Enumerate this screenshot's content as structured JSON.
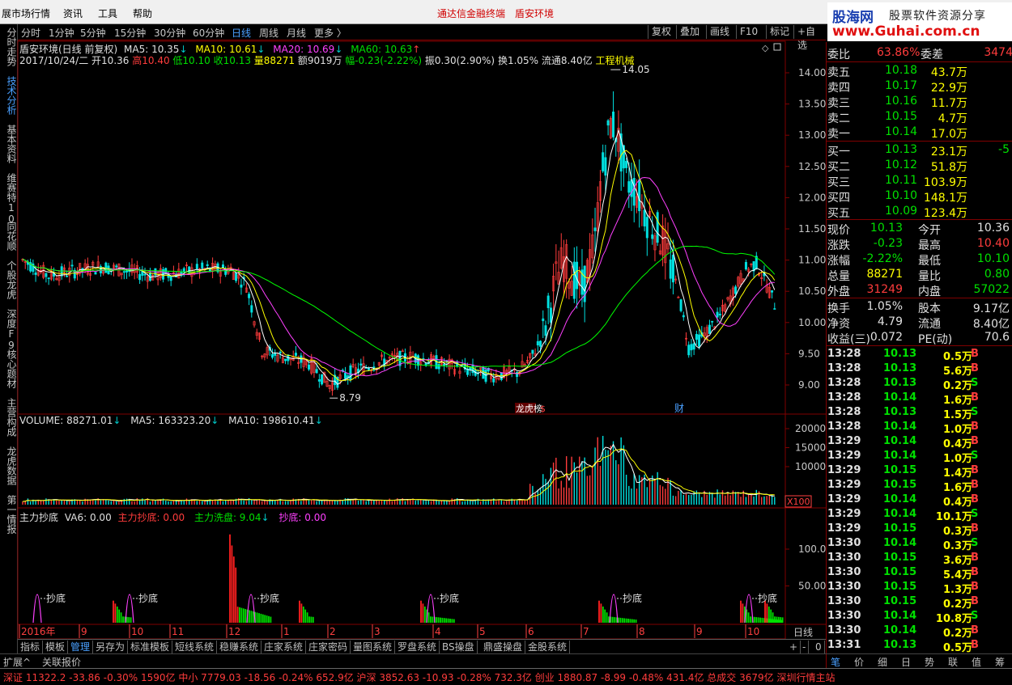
{
  "menubar": {
    "items": [
      "展市场行情",
      "资讯",
      "工具",
      "帮助"
    ],
    "center_links": [
      "通达信金融终端",
      "盾安环境"
    ]
  },
  "logo": {
    "brand": "股海网",
    "slogan": "股票软件资源分享",
    "url": "www.Guhai.com.cn"
  },
  "left_tabs": [
    "分时走势",
    "技术分析",
    "基本资料",
    "维赛特10",
    "同花顺",
    "个股龙虎",
    "深度F9",
    "核心题材",
    "主营构成",
    "龙虎数据",
    "第一情报"
  ],
  "periods": {
    "items": [
      "分时",
      "1分钟",
      "5分钟",
      "15分钟",
      "30分钟",
      "60分钟",
      "日线",
      "周线",
      "月线",
      "更多 〉"
    ],
    "active": "日线",
    "right_buttons": [
      "复权",
      "叠加",
      "画线",
      "F10",
      "标记",
      "+自选"
    ]
  },
  "price_panel": {
    "title": "盾安环境(日线 前复权)",
    "ma": [
      {
        "label": "MA5: 10.35",
        "color": "#ffffff"
      },
      {
        "label": "MA10: 10.61",
        "color": "#ffff00"
      },
      {
        "label": "MA20: 10.69",
        "color": "#ff40ff"
      },
      {
        "label": "MA60: 10.63",
        "color": "#00ff00"
      }
    ],
    "bar_info": {
      "date": "2017/10/24/二",
      "open": "开10.36",
      "high": "高10.40",
      "low": "低10.10",
      "close": "收10.13",
      "vol": "量88271",
      "amount": "额9019万",
      "change": "幅-0.23(-2.22%)",
      "amp": "振0.30(2.90%)",
      "turnover": "换1.05%",
      "float_cap": "流通8.40亿",
      "industry": "工程机械"
    },
    "high_label": "14.05",
    "low_label": "8.79",
    "event_labels": [
      "龙虎榜",
      "$",
      "财"
    ],
    "y_axis": [
      "14.00",
      "13.50",
      "13.00",
      "12.50",
      "12.00",
      "11.50",
      "11.00",
      "10.50",
      "10.00",
      "9.50",
      "9.00"
    ]
  },
  "volume_panel": {
    "title": "VOLUME: 88271.01",
    "ma5": "MA5: 163323.20",
    "ma10": "MA10: 198610.41",
    "y_axis": [
      "20000",
      "15000",
      "10000"
    ],
    "unit": "X100"
  },
  "indicator_panel": {
    "name": "主力抄底",
    "va6": "VA6: 0.00",
    "l1": "主力抄底: 0.00",
    "l2": "主力洗盘: 9.04",
    "l3": "抄底: 0.00",
    "mark_label": "抄底",
    "y_axis": [
      "100.0",
      "50.00"
    ]
  },
  "x_axis": [
    "2016年",
    "9",
    "10",
    "11",
    "12",
    "1",
    "2",
    "3",
    "4",
    "5",
    "6",
    "7",
    "8",
    "9",
    "10"
  ],
  "x_period": "日线",
  "zoom_buttons": [
    "+",
    "-",
    "0"
  ],
  "bottom_tabs": [
    "指标",
    "模板",
    "管理",
    "另存为",
    "标准模板",
    "短线系统",
    "稳赚系统",
    "庄家系统",
    "庄家密码",
    "量图系统",
    "罗盘系统",
    "BS操盘",
    "鼎盛操盘",
    "金股系统"
  ],
  "bottom_active": "管理",
  "ext_tabs": [
    "扩展^",
    "关联报价"
  ],
  "status_bar": "深证 11322.2  -33.86  -0.30%  1590亿  中小 7779.03  -18.56  -0.24%  652.9亿  沪深 3852.63  -10.93  -0.28%  732.3亿  创业 1880.87  -8.99  -0.48%  431.4亿  总成交  3679亿  深圳行情主站",
  "quote": {
    "weibi_label": "委比",
    "weibi": "63.86%",
    "weicha_label": "委差",
    "weicha": "3474",
    "asks": [
      {
        "label": "卖五",
        "price": "10.18",
        "vol": "43.7万"
      },
      {
        "label": "卖四",
        "price": "10.17",
        "vol": "22.9万"
      },
      {
        "label": "卖三",
        "price": "10.16",
        "vol": "11.7万"
      },
      {
        "label": "卖二",
        "price": "10.15",
        "vol": "4.7万"
      },
      {
        "label": "卖一",
        "price": "10.14",
        "vol": "17.0万"
      }
    ],
    "bids": [
      {
        "label": "买一",
        "price": "10.13",
        "vol": "23.1万",
        "chg": "-5"
      },
      {
        "label": "买二",
        "price": "10.12",
        "vol": "51.8万",
        "chg": ""
      },
      {
        "label": "买三",
        "price": "10.11",
        "vol": "103.9万",
        "chg": ""
      },
      {
        "label": "买四",
        "price": "10.10",
        "vol": "148.1万",
        "chg": ""
      },
      {
        "label": "买五",
        "price": "10.09",
        "vol": "123.4万",
        "chg": ""
      }
    ],
    "stats": [
      {
        "l1": "现价",
        "v1": "10.13",
        "c1": "green",
        "l2": "今开",
        "v2": "10.36",
        "c2": "white"
      },
      {
        "l1": "涨跌",
        "v1": "-0.23",
        "c1": "green",
        "l2": "最高",
        "v2": "10.40",
        "c2": "red"
      },
      {
        "l1": "涨幅",
        "v1": "-2.22%",
        "c1": "green",
        "l2": "最低",
        "v2": "10.10",
        "c2": "green"
      },
      {
        "l1": "总量",
        "v1": "88271",
        "c1": "yellow",
        "l2": "量比",
        "v2": "0.80",
        "c2": "green"
      },
      {
        "l1": "外盘",
        "v1": "31249",
        "c1": "red",
        "l2": "内盘",
        "v2": "57022",
        "c2": "green"
      }
    ],
    "stats2": [
      {
        "l1": "换手",
        "v1": "1.05%",
        "l2": "股本",
        "v2": "9.17亿"
      },
      {
        "l1": "净资",
        "v1": "4.79",
        "l2": "流通",
        "v2": "8.40亿"
      },
      {
        "l1": "收益(三)",
        "v1": "0.072",
        "l2": "PE(动)",
        "v2": "70.6"
      }
    ]
  },
  "ticks": [
    {
      "t": "13:28",
      "p": "10.13",
      "v": "0.5万",
      "s": "B"
    },
    {
      "t": "13:28",
      "p": "10.13",
      "v": "5.6万",
      "s": "B"
    },
    {
      "t": "13:28",
      "p": "10.13",
      "v": "0.2万",
      "s": "S"
    },
    {
      "t": "13:28",
      "p": "10.14",
      "v": "1.6万",
      "s": "B"
    },
    {
      "t": "13:28",
      "p": "10.13",
      "v": "1.5万",
      "s": "S"
    },
    {
      "t": "13:28",
      "p": "10.14",
      "v": "1.0万",
      "s": "B"
    },
    {
      "t": "13:29",
      "p": "10.14",
      "v": "0.4万",
      "s": "B"
    },
    {
      "t": "13:29",
      "p": "10.14",
      "v": "1.0万",
      "s": "S"
    },
    {
      "t": "13:29",
      "p": "10.15",
      "v": "1.4万",
      "s": "B"
    },
    {
      "t": "13:29",
      "p": "10.15",
      "v": "1.6万",
      "s": "B"
    },
    {
      "t": "13:29",
      "p": "10.14",
      "v": "0.4万",
      "s": "B"
    },
    {
      "t": "13:29",
      "p": "10.14",
      "v": "10.1万",
      "s": "S"
    },
    {
      "t": "13:29",
      "p": "10.15",
      "v": "0.3万",
      "s": "B"
    },
    {
      "t": "13:30",
      "p": "10.14",
      "v": "0.3万",
      "s": "S"
    },
    {
      "t": "13:30",
      "p": "10.15",
      "v": "3.6万",
      "s": "B"
    },
    {
      "t": "13:30",
      "p": "10.15",
      "v": "5.4万",
      "s": "B"
    },
    {
      "t": "13:30",
      "p": "10.15",
      "v": "1.3万",
      "s": "B"
    },
    {
      "t": "13:30",
      "p": "10.15",
      "v": "0.2万",
      "s": "B"
    },
    {
      "t": "13:30",
      "p": "10.14",
      "v": "10.8万",
      "s": "S"
    },
    {
      "t": "13:30",
      "p": "10.14",
      "v": "0.2万",
      "s": "B"
    },
    {
      "t": "13:31",
      "p": "10.13",
      "v": "0.5万",
      "s": "B"
    }
  ],
  "right_tabs": [
    "笔",
    "价",
    "细",
    "日",
    "势",
    "联",
    "值",
    "筹"
  ],
  "colors": {
    "up": "#ff3c3c",
    "down": "#00e0e0",
    "ma5": "#ffffff",
    "ma10": "#ffff00",
    "ma20": "#ff40ff",
    "ma60": "#00ff00",
    "grid": "#800000",
    "active_tab": "#4aa0ff"
  }
}
